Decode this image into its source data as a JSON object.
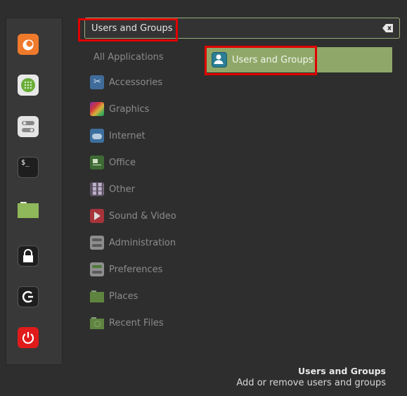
{
  "search": {
    "value": "Users and Groups",
    "clear_icon": "backspace-clear-icon"
  },
  "favorites": [
    {
      "name": "Firefox",
      "icon": "firefox-icon",
      "color": "#f07a2b"
    },
    {
      "name": "Software Manager",
      "icon": "software-manager-icon",
      "color": "#6aae3a"
    },
    {
      "name": "System Settings",
      "icon": "system-settings-icon",
      "color": "#e4e4e4"
    },
    {
      "name": "Terminal",
      "icon": "terminal-icon",
      "color": "#222222"
    },
    {
      "name": "Files",
      "icon": "folder-icon",
      "color": "#8fb85a"
    },
    {
      "name": "Lock Screen",
      "icon": "lock-icon",
      "color": "#222222"
    },
    {
      "name": "Log Out",
      "icon": "logout-icon",
      "color": "#222222"
    },
    {
      "name": "Quit",
      "icon": "power-icon",
      "color": "#e01b1b"
    }
  ],
  "categories_header": "All Applications",
  "categories": [
    {
      "label": "Accessories",
      "icon": "accessories-icon"
    },
    {
      "label": "Graphics",
      "icon": "graphics-icon"
    },
    {
      "label": "Internet",
      "icon": "internet-icon"
    },
    {
      "label": "Office",
      "icon": "office-icon"
    },
    {
      "label": "Other",
      "icon": "other-icon"
    },
    {
      "label": "Sound & Video",
      "icon": "sound-video-icon"
    },
    {
      "label": "Administration",
      "icon": "administration-icon"
    },
    {
      "label": "Preferences",
      "icon": "preferences-icon"
    },
    {
      "label": "Places",
      "icon": "places-folder-icon"
    },
    {
      "label": "Recent Files",
      "icon": "recent-files-icon"
    }
  ],
  "results": [
    {
      "label": "Users and Groups",
      "icon": "users-groups-icon"
    }
  ],
  "description": {
    "title": "Users and Groups",
    "text": "Add or remove users and groups"
  },
  "colors": {
    "accent": "#8fa869",
    "highlight_annotation": "#e00000"
  }
}
